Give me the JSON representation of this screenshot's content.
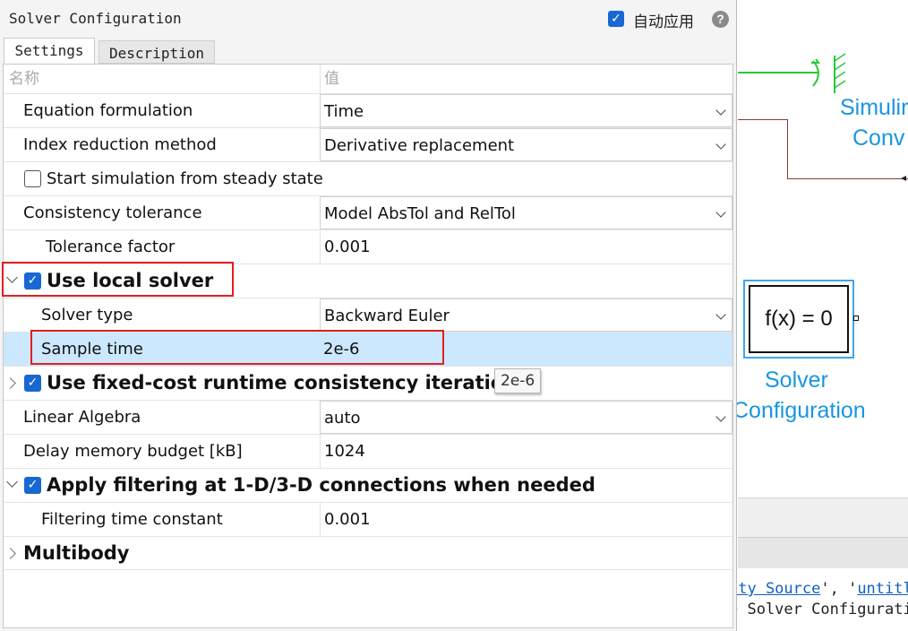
{
  "dialog": {
    "title": "Solver Configuration",
    "auto_apply_label": "自动应用",
    "auto_apply_checked": true,
    "help_icon": "?",
    "tabs": [
      {
        "label": "Settings",
        "active": true
      },
      {
        "label": "Description",
        "active": false
      }
    ],
    "table": {
      "header_name": "名称",
      "header_value": "值",
      "rows": [
        {
          "name": "Equation formulation",
          "value": "Time"
        },
        {
          "name": "Index reduction method",
          "value": "Derivative replacement"
        },
        {
          "name": "Start simulation from steady state",
          "checked": false
        },
        {
          "name": "Consistency tolerance",
          "value": "Model AbsTol and RelTol"
        },
        {
          "name": "Tolerance factor",
          "value": "0.001"
        },
        {
          "name": "Use local solver",
          "checked": true,
          "expanded": true
        },
        {
          "name": "Solver type",
          "value": "Backward Euler"
        },
        {
          "name": "Sample time",
          "value": "2e-6",
          "selected": true
        },
        {
          "name": "Use fixed-cost runtime consistency iterations",
          "checked": true,
          "expanded": false
        },
        {
          "name": "Linear Algebra",
          "value": "auto"
        },
        {
          "name": "Delay memory budget [kB]",
          "value": "1024"
        },
        {
          "name": "Apply filtering at 1-D/3-D connections when needed",
          "checked": true,
          "expanded": true
        },
        {
          "name": "Filtering time constant",
          "value": "0.001"
        },
        {
          "name": "Multibody",
          "expanded": false
        }
      ]
    },
    "tooltip": "2e-6"
  },
  "model": {
    "label_top_1": "Simulir",
    "label_top_2": "Conv",
    "solver_block_text": "f(x) = 0",
    "solver_label_1": "Solver",
    "solver_label_2": "Configuration",
    "command_line_1_link1": "ity Source",
    "command_line_1_sep": "', '",
    "command_line_1_link2": "untitl",
    "command_line_2": "e Solver Configurati"
  },
  "colors": {
    "accent": "#1867d2",
    "selected_row": "#cce8ff",
    "highlight_box": "#e02020",
    "model_label": "#1a96e0"
  }
}
